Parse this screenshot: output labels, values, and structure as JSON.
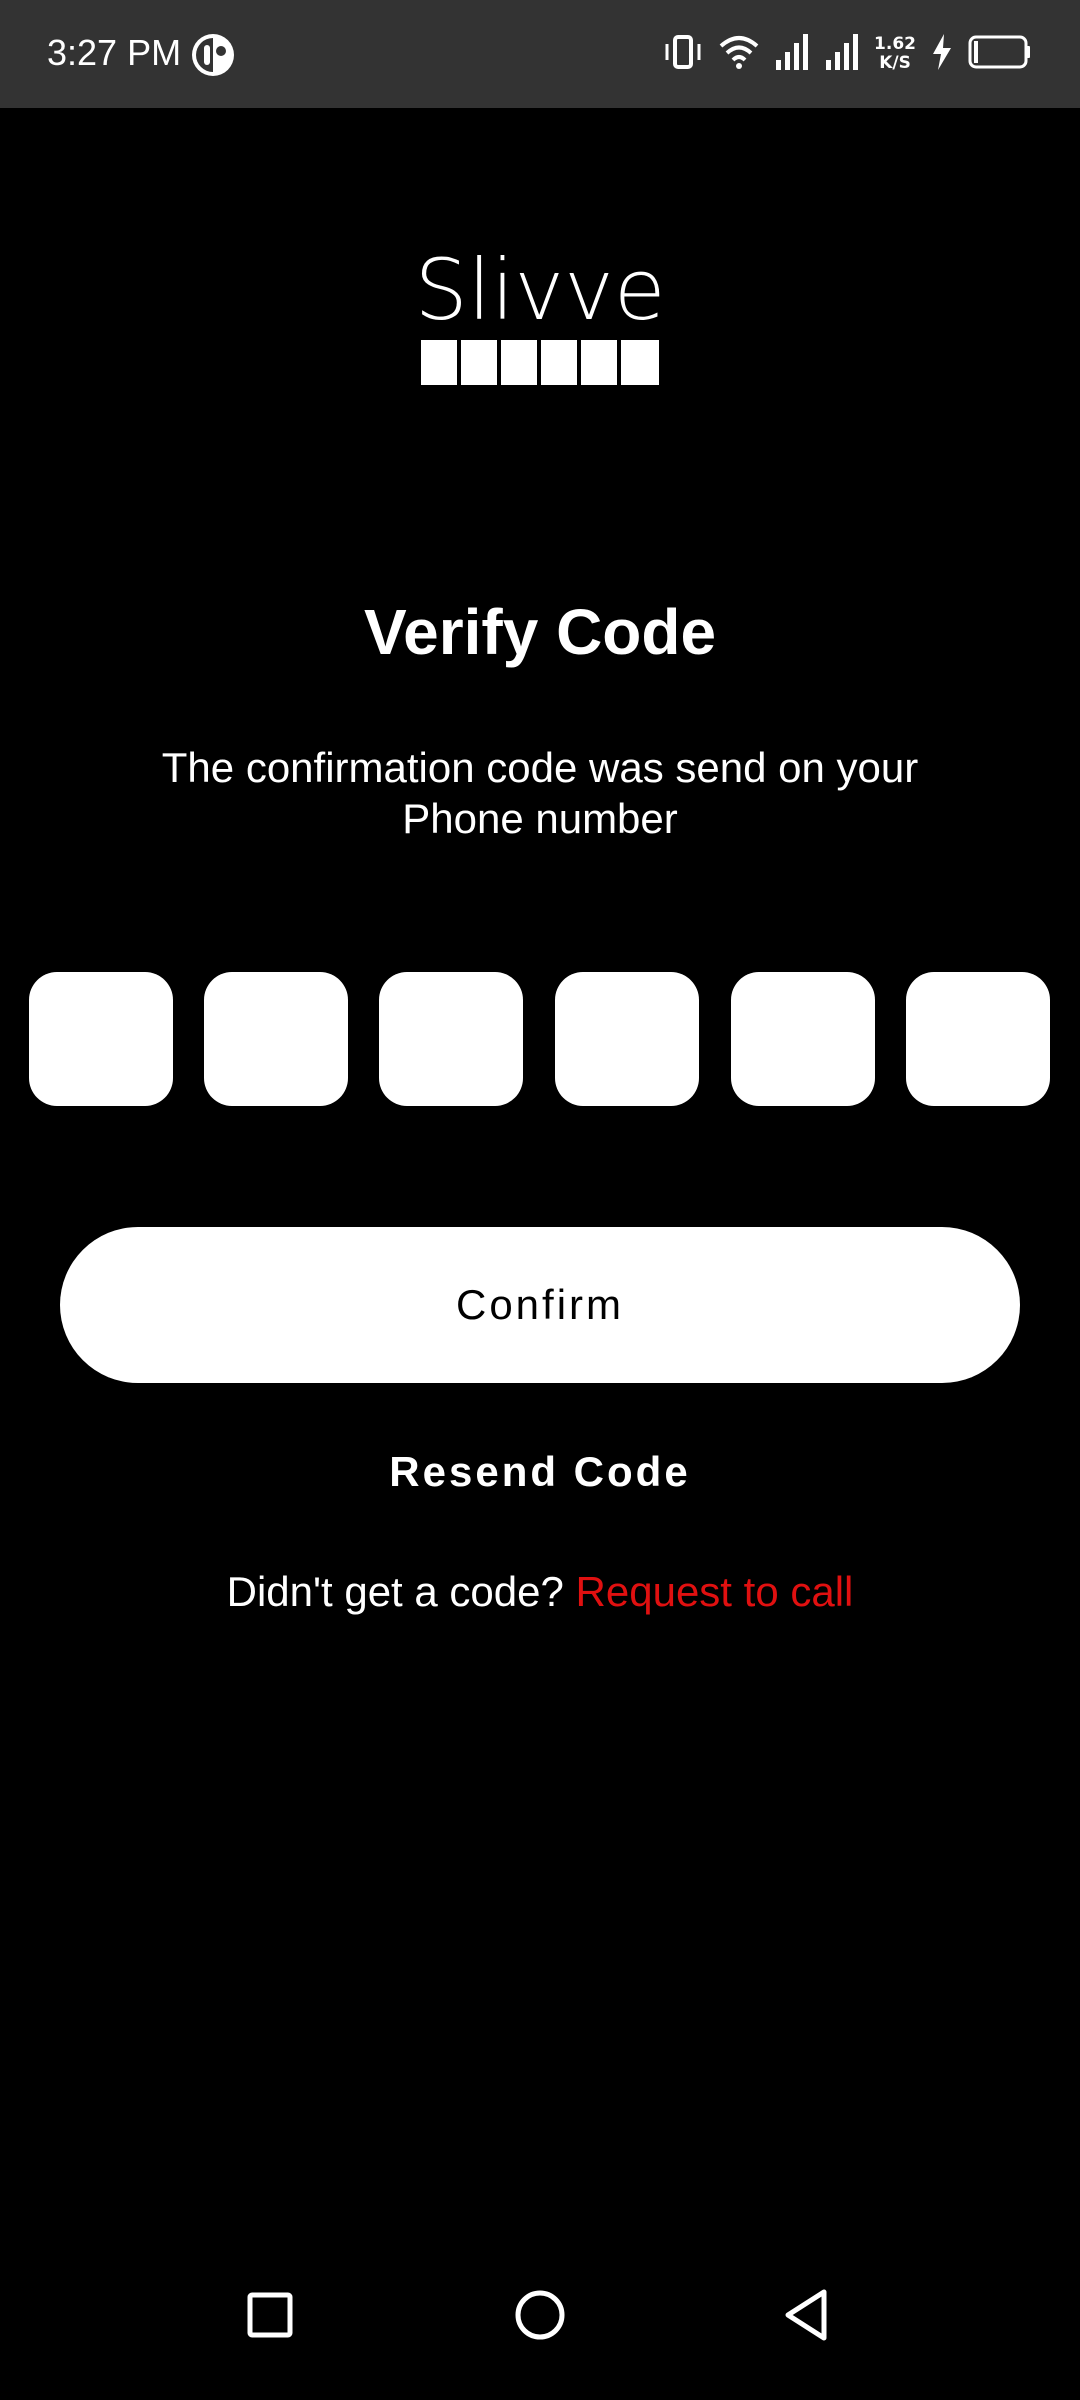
{
  "status_bar": {
    "time": "3:27 PM",
    "net_speed_value": "1.62",
    "net_speed_unit": "K/S",
    "app_icon": "app-notification-icon",
    "icons": [
      "vibrate-icon",
      "wifi-icon",
      "signal-icon",
      "signal-icon",
      "charging-icon",
      "battery-icon"
    ]
  },
  "logo": {
    "text": "Slivve"
  },
  "screen": {
    "title": "Verify Code",
    "subtitle": "The confirmation code was send on your Phone number"
  },
  "code_inputs": {
    "count": 6,
    "values": [
      "",
      "",
      "",
      "",
      "",
      ""
    ]
  },
  "actions": {
    "confirm_label": "Confirm",
    "resend_label": "Resend Code",
    "no_code_prompt": "Didn't get a code?",
    "request_call_label": "Request to call"
  },
  "colors": {
    "background": "#000000",
    "status_bar": "#333333",
    "accent_red": "#e01010",
    "surface": "#ffffff"
  },
  "nav_bar": {
    "icons": [
      "recents-square-icon",
      "home-circle-icon",
      "back-triangle-icon"
    ]
  }
}
